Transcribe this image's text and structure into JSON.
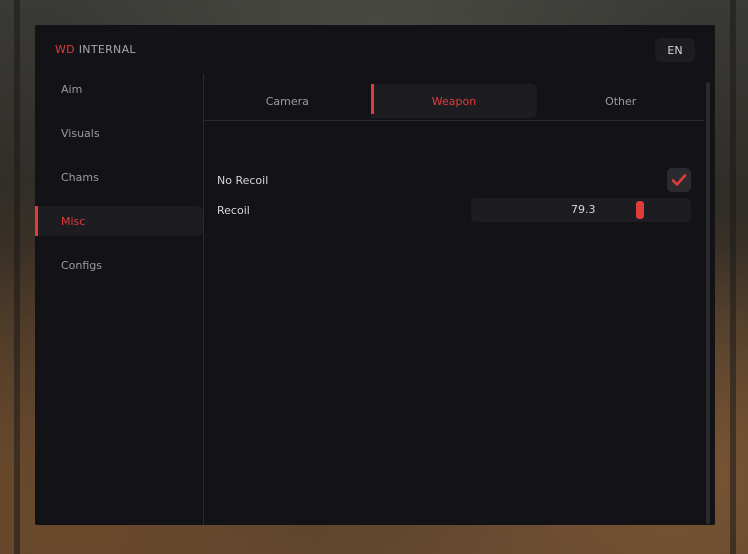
{
  "header": {
    "brand": "WD",
    "title": "INTERNAL",
    "language": "EN"
  },
  "sidebar": {
    "items": [
      {
        "label": "Aim",
        "active": false
      },
      {
        "label": "Visuals",
        "active": false
      },
      {
        "label": "Chams",
        "active": false
      },
      {
        "label": "Misc",
        "active": true
      },
      {
        "label": "Configs",
        "active": false
      }
    ]
  },
  "tabs": [
    {
      "label": "Camera",
      "active": false
    },
    {
      "label": "Weapon",
      "active": true
    },
    {
      "label": "Other",
      "active": false
    }
  ],
  "settings": {
    "no_recoil": {
      "label": "No Recoil",
      "checked": true
    },
    "recoil": {
      "label": "Recoil",
      "value": "79.3",
      "fraction": 0.793
    }
  },
  "colors": {
    "accent": "#e03c3c",
    "panel": "#131317",
    "control": "#1c1c21"
  }
}
